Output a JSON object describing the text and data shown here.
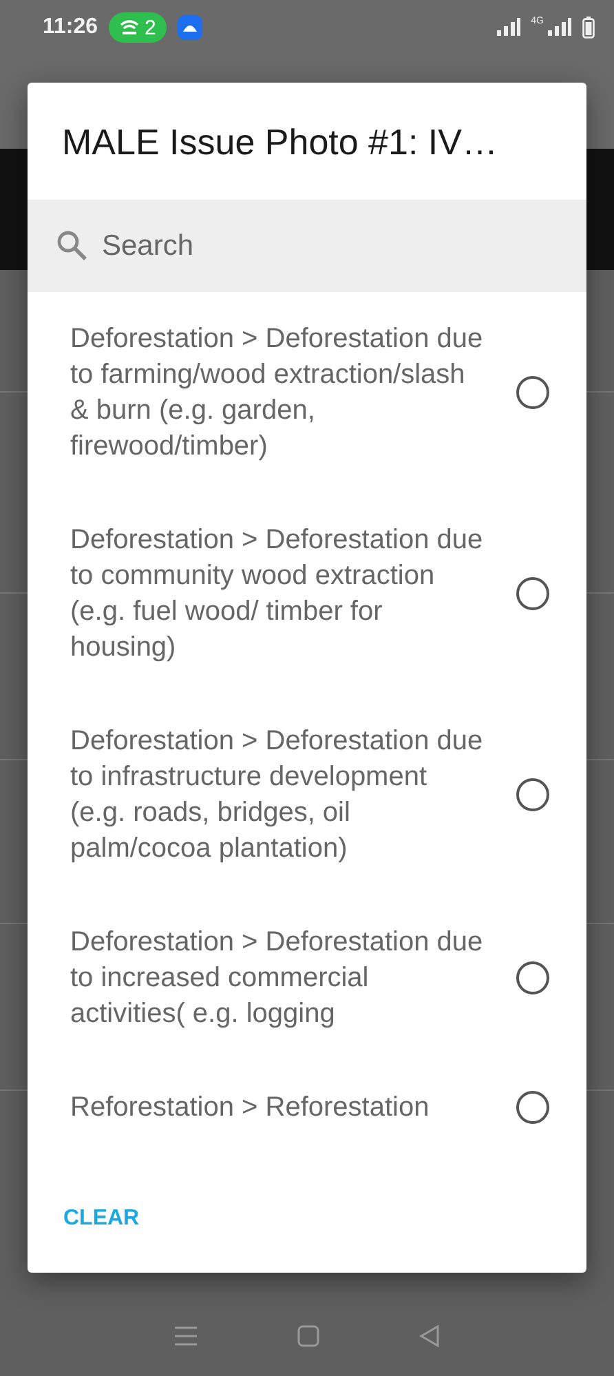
{
  "status_bar": {
    "time": "11:26",
    "hotspot_count": "2",
    "network": "4G"
  },
  "dialog": {
    "title": "MALE Issue Photo #1: IV…",
    "search": {
      "placeholder": "Search"
    },
    "options": [
      {
        "label": "Deforestation > Deforestation due to farming/wood extraction/slash & burn (e.g. garden, firewood/timber)",
        "selected": false
      },
      {
        "label": "Deforestation > Deforestation due to community wood extraction (e.g. fuel wood/ timber for housing)",
        "selected": false
      },
      {
        "label": "Deforestation > Deforestation due to infrastructure development (e.g. roads, bridges, oil palm/cocoa plantation)",
        "selected": false
      },
      {
        "label": "Deforestation > Deforestation due to increased commercial activities( e.g. logging",
        "selected": false
      },
      {
        "label": "Reforestation > Reforestation",
        "selected": false
      }
    ],
    "buttons": [
      "CLEAR"
    ]
  }
}
